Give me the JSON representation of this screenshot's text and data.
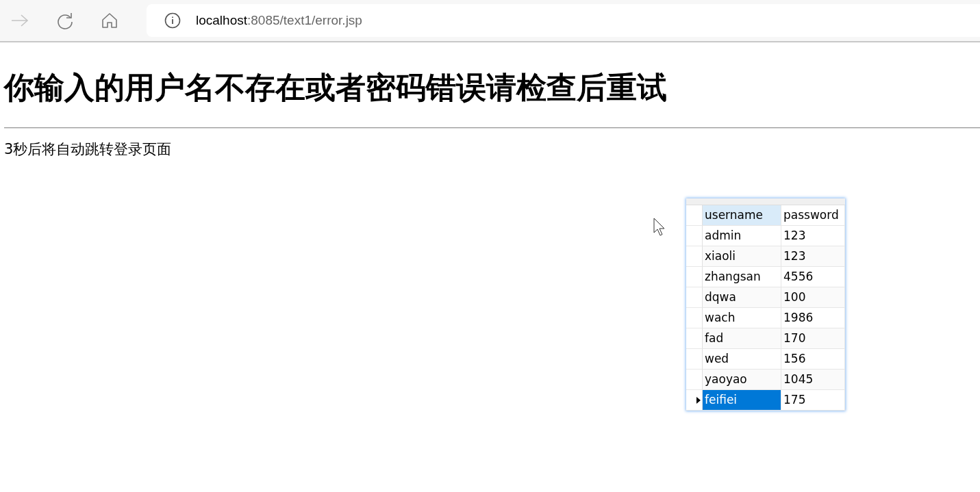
{
  "browser": {
    "address": {
      "host": "localhost",
      "path": ":8085/text1/error.jsp"
    }
  },
  "page": {
    "heading": "你输入的用户名不存在或者密码错误请检查后重试",
    "message": "3秒后将自动跳转登录页面"
  },
  "table": {
    "columns": [
      "username",
      "password"
    ],
    "rows": [
      {
        "cells": [
          "admin",
          "123"
        ],
        "selected": false
      },
      {
        "cells": [
          "xiaoli",
          "123"
        ],
        "selected": false
      },
      {
        "cells": [
          "zhangsan",
          "4556"
        ],
        "selected": false
      },
      {
        "cells": [
          "dqwa",
          "100"
        ],
        "selected": false
      },
      {
        "cells": [
          "wach",
          "1986"
        ],
        "selected": false
      },
      {
        "cells": [
          "fad",
          "170"
        ],
        "selected": false
      },
      {
        "cells": [
          "wed",
          "156"
        ],
        "selected": false
      },
      {
        "cells": [
          "yaoyao",
          "1045"
        ],
        "selected": false
      },
      {
        "cells": [
          "feifiei",
          "175"
        ],
        "selected": true
      }
    ]
  }
}
